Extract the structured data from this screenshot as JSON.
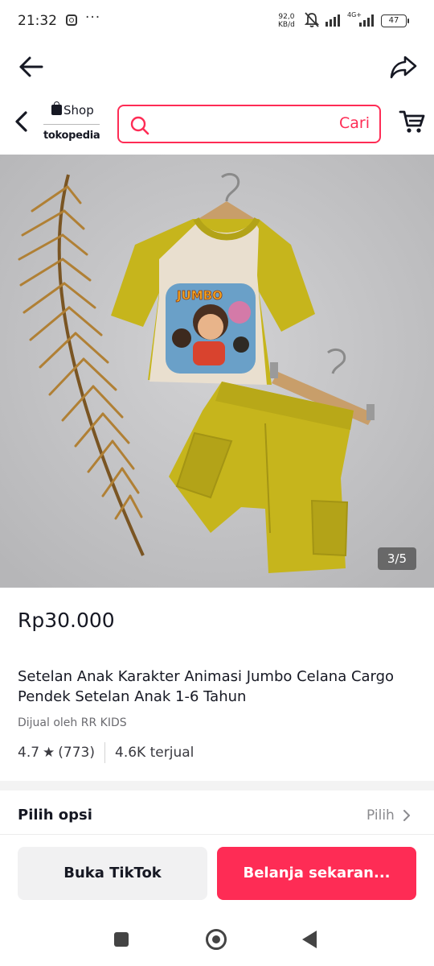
{
  "status_bar": {
    "time": "21:32",
    "more": "···",
    "speed_value": "92,0",
    "speed_unit": "KB/d",
    "network": "4G+",
    "battery": "47"
  },
  "header": {
    "brand_shop": "Shop",
    "brand_name": "tokopedia",
    "search_placeholder": "",
    "search_button": "Cari"
  },
  "product": {
    "image_counter": "3/5",
    "price": "Rp30.000",
    "title": "Setelan Anak Karakter Animasi Jumbo Celana Cargo Pendek Setelan Anak 1-6 Tahun",
    "seller": "Dijual oleh RR KIDS",
    "rating": "4.7",
    "review_count": "(773)",
    "sold": "4.6K terjual",
    "print_text": "JUMBO"
  },
  "options": {
    "label": "Pilih opsi",
    "action": "Pilih"
  },
  "actions": {
    "open_tiktok": "Buka TikTok",
    "buy_now": "Belanja sekaran..."
  },
  "colors": {
    "accent": "#fe2c55",
    "garment_yellow": "#c6b51c",
    "shirt_body": "#e9dfcf",
    "background_photo": "#c6c6c8"
  }
}
